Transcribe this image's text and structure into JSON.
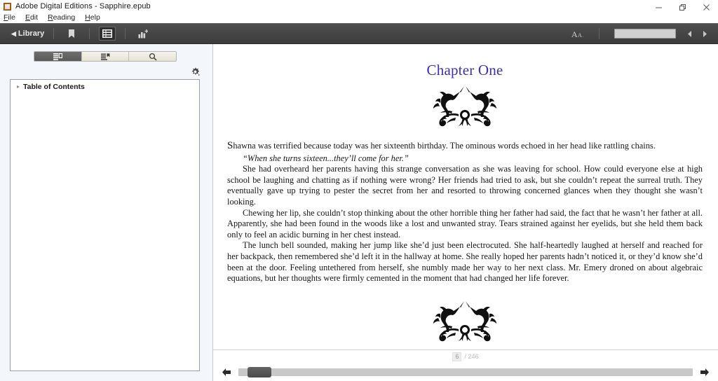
{
  "window": {
    "title": "Adobe Digital Editions - Sapphire.epub",
    "app_icon": "adobe-digital-editions-icon",
    "controls": {
      "minimize": "minimize-icon",
      "restore": "restore-icon",
      "close": "close-icon"
    }
  },
  "menubar": {
    "items": [
      {
        "label": "File",
        "mnemonic": "F"
      },
      {
        "label": "Edit",
        "mnemonic": "E"
      },
      {
        "label": "Reading",
        "mnemonic": "R"
      },
      {
        "label": "Help",
        "mnemonic": "H"
      }
    ]
  },
  "toolbar": {
    "library_label": "Library",
    "library_caret": "◀",
    "icons": [
      {
        "name": "bookmark-icon",
        "active": false
      },
      {
        "name": "table-of-contents-icon",
        "active": true
      },
      {
        "name": "add-highlight-icon",
        "active": false
      }
    ],
    "font_size_label": "AA",
    "search_value": "",
    "search_placeholder": "",
    "prev_label": "◀",
    "next_label": "▶",
    "background": "#444444"
  },
  "sidebar": {
    "tabs": [
      {
        "name": "tab-contents",
        "icon": "list-contents-icon",
        "selected": true
      },
      {
        "name": "tab-bookmarks",
        "icon": "bookmarks-list-icon",
        "selected": false
      },
      {
        "name": "tab-search",
        "icon": "search-icon",
        "selected": false
      }
    ],
    "gear_icon": "gear-icon",
    "toc": {
      "twisty": "▸",
      "root_label": "Table of Contents",
      "items": []
    }
  },
  "reader": {
    "chapter_title": "Chapter One",
    "title_color": "#3b2fb5",
    "ornament_top": "unicorn-flourish-ornament",
    "ornament_bottom": "unicorn-flourish-ornament",
    "paragraphs": [
      {
        "style": "first",
        "dropcap": "S",
        "text": "hawna was terrified because today was her sixteenth birthday. The ominous words echoed in her head like rattling chains."
      },
      {
        "style": "quote",
        "text": "“When she turns sixteen...they’ll come for her.”"
      },
      {
        "style": "body",
        "text": "She had overheard her parents having this strange conversation as she was leaving for school. How could everyone else at high school be laughing and chatting as if nothing were wrong? Her friends had tried to ask, but she couldn’t repeat the surreal truth. They eventually gave up trying to pester the secret from her and resorted to throwing concerned glances when they thought she wasn’t looking."
      },
      {
        "style": "body",
        "text": "Chewing her lip, she couldn’t stop thinking about the other horrible thing her father had said, the fact that he wasn’t her father at all. Apparently, she had been found in the woods like a lost and unwanted stray. Tears strained against her eyelids, but she held them back only to feel an acidic burning in her chest instead."
      },
      {
        "style": "body",
        "text": "The lunch bell sounded, making her jump like she’d just been electrocuted. She half-heartedly laughed at herself and reached for her backpack, then remembered she’d left it in the hallway at home. She really hoped her parents hadn’t noticed it, or they’d know she’d been at the door. Feeling untethered from herself, she numbly made her way to her next class. Mr. Emery droned on about algebraic equations, but her thoughts were firmly cemented in the moment that had changed her life forever."
      }
    ]
  },
  "status": {
    "current_page": "6",
    "separator": "/",
    "total_pages": "246"
  },
  "scrollbar": {
    "left_arrow": "◀",
    "right_arrow": "▶",
    "thumb_position_percent": 2
  }
}
